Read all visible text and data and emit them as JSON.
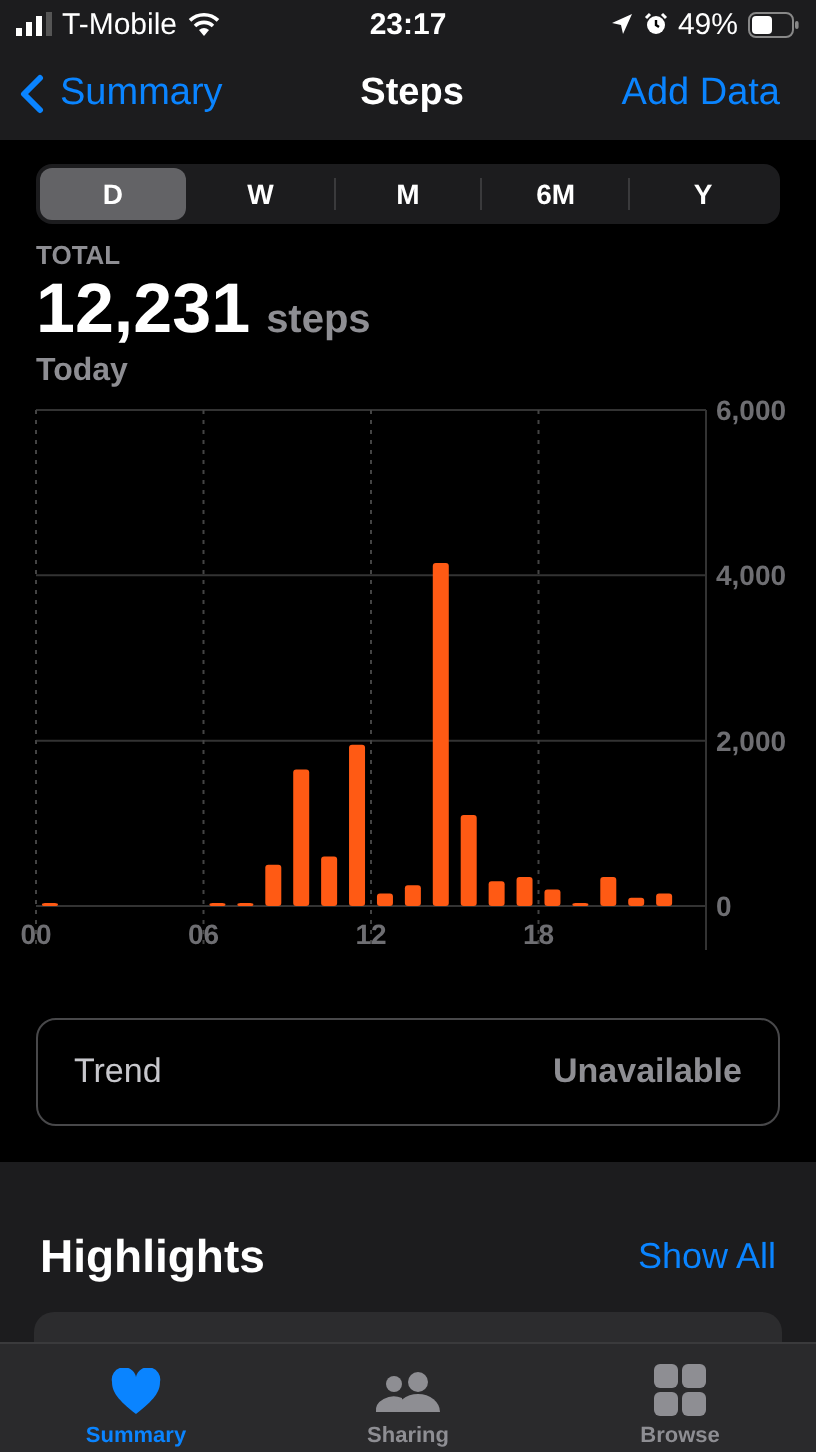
{
  "status_bar": {
    "carrier": "T-Mobile",
    "time": "23:17",
    "battery": "49%"
  },
  "nav": {
    "back": "Summary",
    "title": "Steps",
    "action": "Add Data"
  },
  "segments": [
    {
      "label": "D",
      "selected": true
    },
    {
      "label": "W",
      "selected": false
    },
    {
      "label": "M",
      "selected": false
    },
    {
      "label": "6M",
      "selected": false
    },
    {
      "label": "Y",
      "selected": false
    }
  ],
  "summary": {
    "label": "TOTAL",
    "value": "12,231",
    "unit": "steps",
    "period": "Today"
  },
  "chart_data": {
    "type": "bar",
    "x": [
      0.5,
      6.5,
      7.5,
      8.5,
      9.5,
      10.5,
      11.5,
      12.5,
      13.5,
      14.5,
      15.5,
      16.5,
      17.5,
      18.5,
      19.5,
      20.5,
      21.5,
      22.5
    ],
    "series": [
      {
        "color": "#ff5a14",
        "values": [
          0,
          0,
          0,
          500,
          1650,
          600,
          1950,
          150,
          250,
          4150,
          1100,
          300,
          350,
          200,
          0,
          350,
          100,
          150
        ]
      }
    ],
    "grid": true,
    "xlim": [
      0,
      24
    ],
    "ylim": [
      0,
      6000
    ],
    "yticks": [
      0,
      {
        "value": 2000,
        "label": "2,000"
      },
      {
        "value": 4000,
        "label": "4,000"
      },
      {
        "value": 6000,
        "label": "6,000"
      }
    ],
    "xticks": [
      {
        "value": 0,
        "label": "00"
      },
      {
        "value": 6,
        "label": "06"
      },
      {
        "value": 12,
        "label": "12"
      },
      {
        "value": 18,
        "label": "18"
      }
    ]
  },
  "trend": {
    "label": "Trend",
    "value": "Unavailable"
  },
  "highlights": {
    "title": "Highlights",
    "action": "Show All"
  },
  "tabs": [
    {
      "label": "Summary",
      "selected": true
    },
    {
      "label": "Sharing",
      "selected": false
    },
    {
      "label": "Browse",
      "selected": false
    }
  ]
}
